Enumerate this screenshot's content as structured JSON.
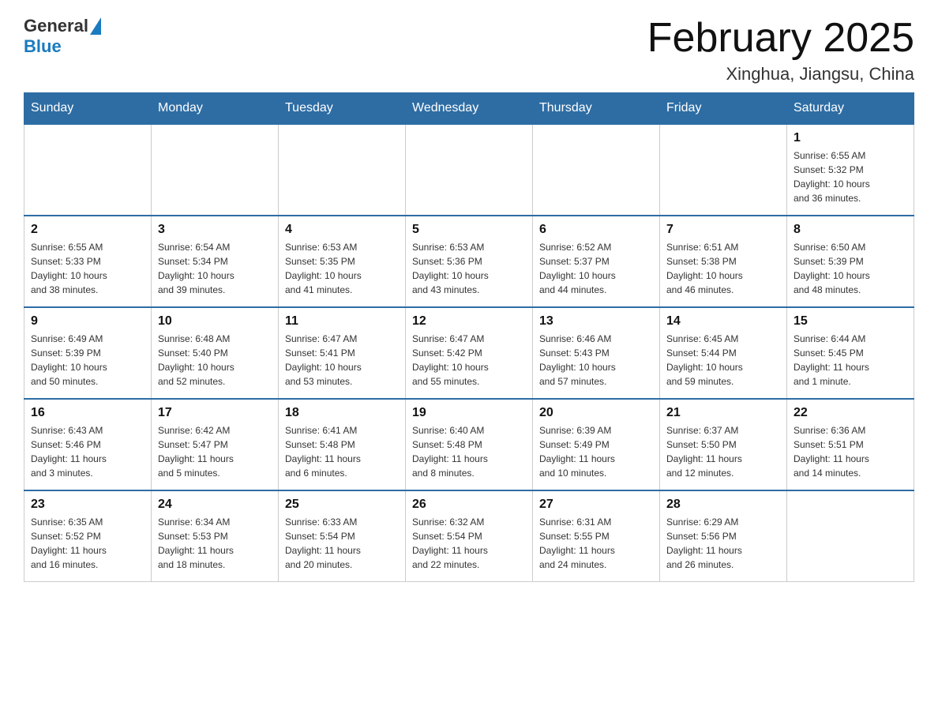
{
  "header": {
    "logo_general": "General",
    "logo_blue": "Blue",
    "title": "February 2025",
    "location": "Xinghua, Jiangsu, China"
  },
  "days_of_week": [
    "Sunday",
    "Monday",
    "Tuesday",
    "Wednesday",
    "Thursday",
    "Friday",
    "Saturday"
  ],
  "weeks": [
    [
      {
        "day": "",
        "info": ""
      },
      {
        "day": "",
        "info": ""
      },
      {
        "day": "",
        "info": ""
      },
      {
        "day": "",
        "info": ""
      },
      {
        "day": "",
        "info": ""
      },
      {
        "day": "",
        "info": ""
      },
      {
        "day": "1",
        "info": "Sunrise: 6:55 AM\nSunset: 5:32 PM\nDaylight: 10 hours\nand 36 minutes."
      }
    ],
    [
      {
        "day": "2",
        "info": "Sunrise: 6:55 AM\nSunset: 5:33 PM\nDaylight: 10 hours\nand 38 minutes."
      },
      {
        "day": "3",
        "info": "Sunrise: 6:54 AM\nSunset: 5:34 PM\nDaylight: 10 hours\nand 39 minutes."
      },
      {
        "day": "4",
        "info": "Sunrise: 6:53 AM\nSunset: 5:35 PM\nDaylight: 10 hours\nand 41 minutes."
      },
      {
        "day": "5",
        "info": "Sunrise: 6:53 AM\nSunset: 5:36 PM\nDaylight: 10 hours\nand 43 minutes."
      },
      {
        "day": "6",
        "info": "Sunrise: 6:52 AM\nSunset: 5:37 PM\nDaylight: 10 hours\nand 44 minutes."
      },
      {
        "day": "7",
        "info": "Sunrise: 6:51 AM\nSunset: 5:38 PM\nDaylight: 10 hours\nand 46 minutes."
      },
      {
        "day": "8",
        "info": "Sunrise: 6:50 AM\nSunset: 5:39 PM\nDaylight: 10 hours\nand 48 minutes."
      }
    ],
    [
      {
        "day": "9",
        "info": "Sunrise: 6:49 AM\nSunset: 5:39 PM\nDaylight: 10 hours\nand 50 minutes."
      },
      {
        "day": "10",
        "info": "Sunrise: 6:48 AM\nSunset: 5:40 PM\nDaylight: 10 hours\nand 52 minutes."
      },
      {
        "day": "11",
        "info": "Sunrise: 6:47 AM\nSunset: 5:41 PM\nDaylight: 10 hours\nand 53 minutes."
      },
      {
        "day": "12",
        "info": "Sunrise: 6:47 AM\nSunset: 5:42 PM\nDaylight: 10 hours\nand 55 minutes."
      },
      {
        "day": "13",
        "info": "Sunrise: 6:46 AM\nSunset: 5:43 PM\nDaylight: 10 hours\nand 57 minutes."
      },
      {
        "day": "14",
        "info": "Sunrise: 6:45 AM\nSunset: 5:44 PM\nDaylight: 10 hours\nand 59 minutes."
      },
      {
        "day": "15",
        "info": "Sunrise: 6:44 AM\nSunset: 5:45 PM\nDaylight: 11 hours\nand 1 minute."
      }
    ],
    [
      {
        "day": "16",
        "info": "Sunrise: 6:43 AM\nSunset: 5:46 PM\nDaylight: 11 hours\nand 3 minutes."
      },
      {
        "day": "17",
        "info": "Sunrise: 6:42 AM\nSunset: 5:47 PM\nDaylight: 11 hours\nand 5 minutes."
      },
      {
        "day": "18",
        "info": "Sunrise: 6:41 AM\nSunset: 5:48 PM\nDaylight: 11 hours\nand 6 minutes."
      },
      {
        "day": "19",
        "info": "Sunrise: 6:40 AM\nSunset: 5:48 PM\nDaylight: 11 hours\nand 8 minutes."
      },
      {
        "day": "20",
        "info": "Sunrise: 6:39 AM\nSunset: 5:49 PM\nDaylight: 11 hours\nand 10 minutes."
      },
      {
        "day": "21",
        "info": "Sunrise: 6:37 AM\nSunset: 5:50 PM\nDaylight: 11 hours\nand 12 minutes."
      },
      {
        "day": "22",
        "info": "Sunrise: 6:36 AM\nSunset: 5:51 PM\nDaylight: 11 hours\nand 14 minutes."
      }
    ],
    [
      {
        "day": "23",
        "info": "Sunrise: 6:35 AM\nSunset: 5:52 PM\nDaylight: 11 hours\nand 16 minutes."
      },
      {
        "day": "24",
        "info": "Sunrise: 6:34 AM\nSunset: 5:53 PM\nDaylight: 11 hours\nand 18 minutes."
      },
      {
        "day": "25",
        "info": "Sunrise: 6:33 AM\nSunset: 5:54 PM\nDaylight: 11 hours\nand 20 minutes."
      },
      {
        "day": "26",
        "info": "Sunrise: 6:32 AM\nSunset: 5:54 PM\nDaylight: 11 hours\nand 22 minutes."
      },
      {
        "day": "27",
        "info": "Sunrise: 6:31 AM\nSunset: 5:55 PM\nDaylight: 11 hours\nand 24 minutes."
      },
      {
        "day": "28",
        "info": "Sunrise: 6:29 AM\nSunset: 5:56 PM\nDaylight: 11 hours\nand 26 minutes."
      },
      {
        "day": "",
        "info": ""
      }
    ]
  ]
}
